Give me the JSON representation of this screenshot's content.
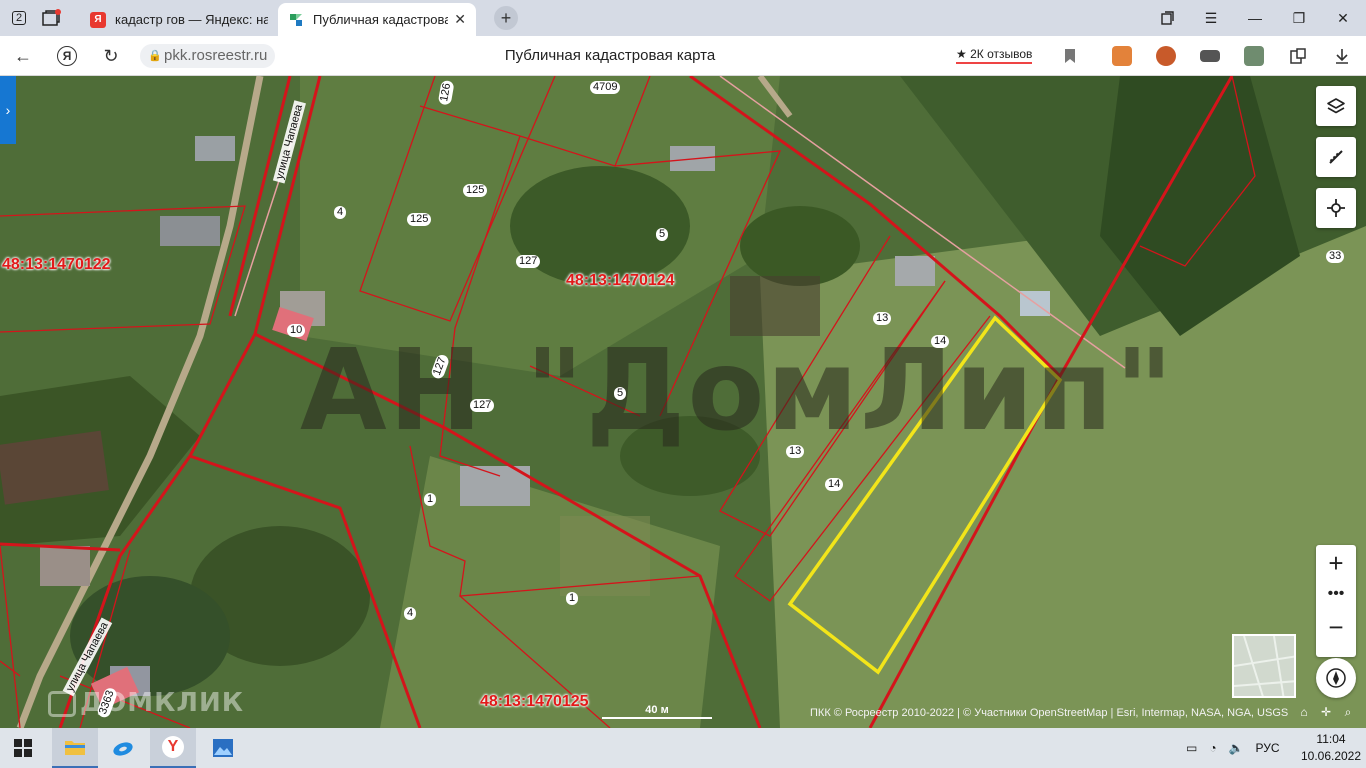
{
  "browser": {
    "tab_counter": "2",
    "tabs": [
      {
        "title": "кадастр гов — Яндекс: нашл",
        "favicon": "Я",
        "favicon_color": "#e8382f"
      },
      {
        "title": "Публичная кадастровая кар",
        "favicon": "",
        "favicon_color": "#2a9d5c"
      }
    ],
    "url": "pkk.rosreestr.ru",
    "page_title": "Публичная кадастровая карта",
    "reviews": "★ 2К отзывов"
  },
  "map": {
    "watermark": "АН \"ДомЛип\"",
    "brand_watermark": "ДОМКЛИК",
    "cadastral_quarters": [
      "48:13:1470122",
      "48:13:1470124",
      "48:13:1470125"
    ],
    "plot_numbers": [
      "126",
      "4709",
      "125",
      "125",
      "4",
      "127",
      "5",
      "33",
      "10",
      "13",
      "14",
      "127",
      "127",
      "5",
      "13",
      "14",
      "1",
      "1",
      "4",
      "3363"
    ],
    "streets": [
      "улица Чапаева",
      "улица Чапаева"
    ],
    "scale_label": "40 м",
    "copyright": "ПКК © Росреестр 2010-2022 | © Участники OpenStreetMap | Esri, Intermap, NASA, NGA, USGS",
    "accent_color": "#e21a1a",
    "highlight_color": "#f2e51a"
  },
  "taskbar": {
    "language": "РУС",
    "time": "11:04",
    "date": "10.06.2022"
  }
}
